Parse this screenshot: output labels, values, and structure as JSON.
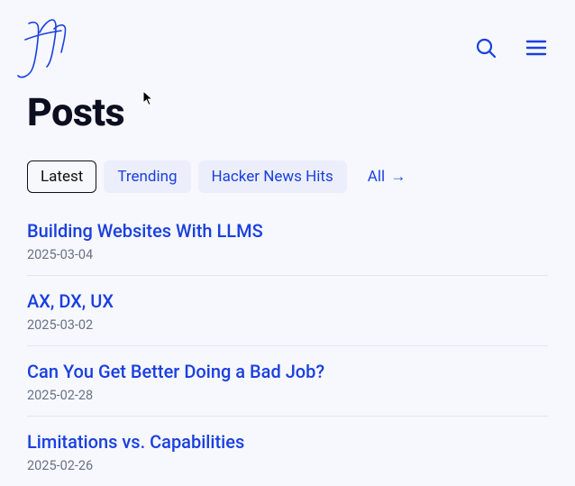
{
  "header": {
    "logo_label": "JM monogram"
  },
  "page": {
    "title": "Posts"
  },
  "tabs": [
    {
      "label": "Latest",
      "active": true,
      "plain": false,
      "arrow": false
    },
    {
      "label": "Trending",
      "active": false,
      "plain": false,
      "arrow": false
    },
    {
      "label": "Hacker News Hits",
      "active": false,
      "plain": false,
      "arrow": false
    },
    {
      "label": "All",
      "active": false,
      "plain": true,
      "arrow": true
    }
  ],
  "arrow_glyph": "→",
  "posts": [
    {
      "title": "Building Websites With LLMS",
      "date": "2025-03-04"
    },
    {
      "title": "AX, DX, UX",
      "date": "2025-03-02"
    },
    {
      "title": "Can You Get Better Doing a Bad Job?",
      "date": "2025-02-28"
    },
    {
      "title": "Limitations vs. Capabilities",
      "date": "2025-02-26"
    }
  ]
}
